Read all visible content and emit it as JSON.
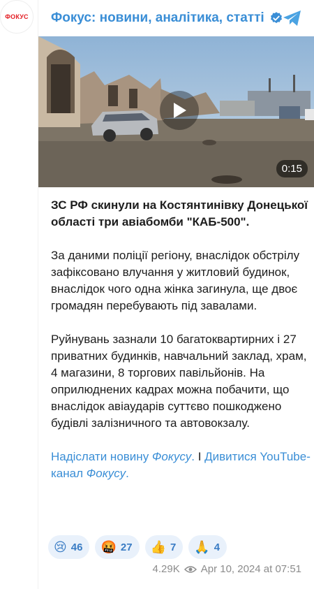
{
  "channel": {
    "avatar_text": "ФОКУС",
    "title": "Фокус: новини, аналітика, статті",
    "verified_icon": "verified-icon",
    "app_icon": "telegram-icon",
    "accent_color": "#3a8ed6"
  },
  "video": {
    "duration": "0:15",
    "play_icon": "play-icon"
  },
  "post": {
    "headline": "ЗС РФ скинули на Костянтинівку Донецької області три авіабомби \"КАБ-500\".",
    "paragraph1": "За даними поліції регіону, внаслідок обстрілу зафіксовано влучання у житловий будинок, внаслідок чого одна жінка загинула, ще двоє громадян перебувають під завалами.",
    "paragraph2": "Руйнувань зазнали 10 багатоквартирних і 27 приватних будинків, навчальний заклад, храм, 4 магазини, 8 торгових павільйонів. На оприлюднених кадрах можна побачити, що внаслідок авіаударів суттєво пошкоджено будівлі залізничного та автовокзалу.",
    "link1_prefix": "Надіслати новину ",
    "link1_italic": "Фокусу",
    "link1_suffix": ".",
    "separator": " І ",
    "link2_prefix": "Дивитися YouTube-канал ",
    "link2_italic": "Фокусу",
    "link2_suffix": "."
  },
  "reactions": [
    {
      "emoji": "😢",
      "count": "46"
    },
    {
      "emoji": "🤬",
      "count": "27"
    },
    {
      "emoji": "👍",
      "count": "7"
    },
    {
      "emoji": "🙏",
      "count": "4"
    }
  ],
  "meta": {
    "views": "4.29K",
    "views_icon": "eye-icon",
    "date": "Apr 10, 2024 at 07:51"
  }
}
